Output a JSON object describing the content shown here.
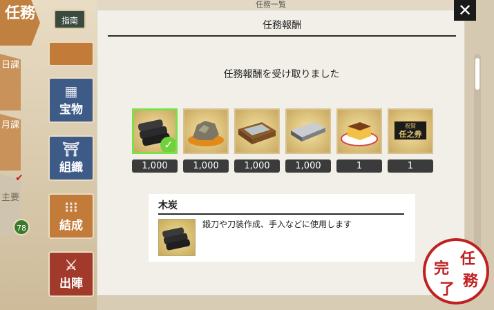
{
  "header": {
    "title": "任務",
    "guide_label": "指南",
    "bg_title": "任務一覧"
  },
  "sidebar_tabs": [
    {
      "label": "日課"
    },
    {
      "label": "月課"
    },
    {
      "label": "主要",
      "badge": "78"
    }
  ],
  "menu_buttons": [
    {
      "label": "宝物",
      "icon": "treasure-icon"
    },
    {
      "label": "組織",
      "icon": "organization-icon"
    },
    {
      "label": "結成",
      "icon": "formation-icon"
    },
    {
      "label": "出陣",
      "icon": "sortie-icon"
    }
  ],
  "dialog": {
    "title": "任務報酬",
    "message": "任務報酬を受け取りました",
    "items": [
      {
        "name": "charcoal-item",
        "quantity": "1,000",
        "selected": true
      },
      {
        "name": "ore-item",
        "quantity": "1,000"
      },
      {
        "name": "whetstone-item",
        "quantity": "1,000"
      },
      {
        "name": "steel-item",
        "quantity": "1,000"
      },
      {
        "name": "castella-item",
        "quantity": "1"
      },
      {
        "name": "ticket-item",
        "quantity": "1",
        "icon_text_top": "祝賀",
        "icon_text_main": "任之券"
      }
    ],
    "detail": {
      "title": "木炭",
      "description": "鍛刀や刀装作成、手入などに使用します"
    }
  },
  "stamp": {
    "text": [
      "完",
      "任",
      "了",
      "務"
    ]
  },
  "colors": {
    "accent_green": "#7ce04a",
    "stamp_red": "#c02020",
    "qty_bg": "#3b3b3b"
  }
}
